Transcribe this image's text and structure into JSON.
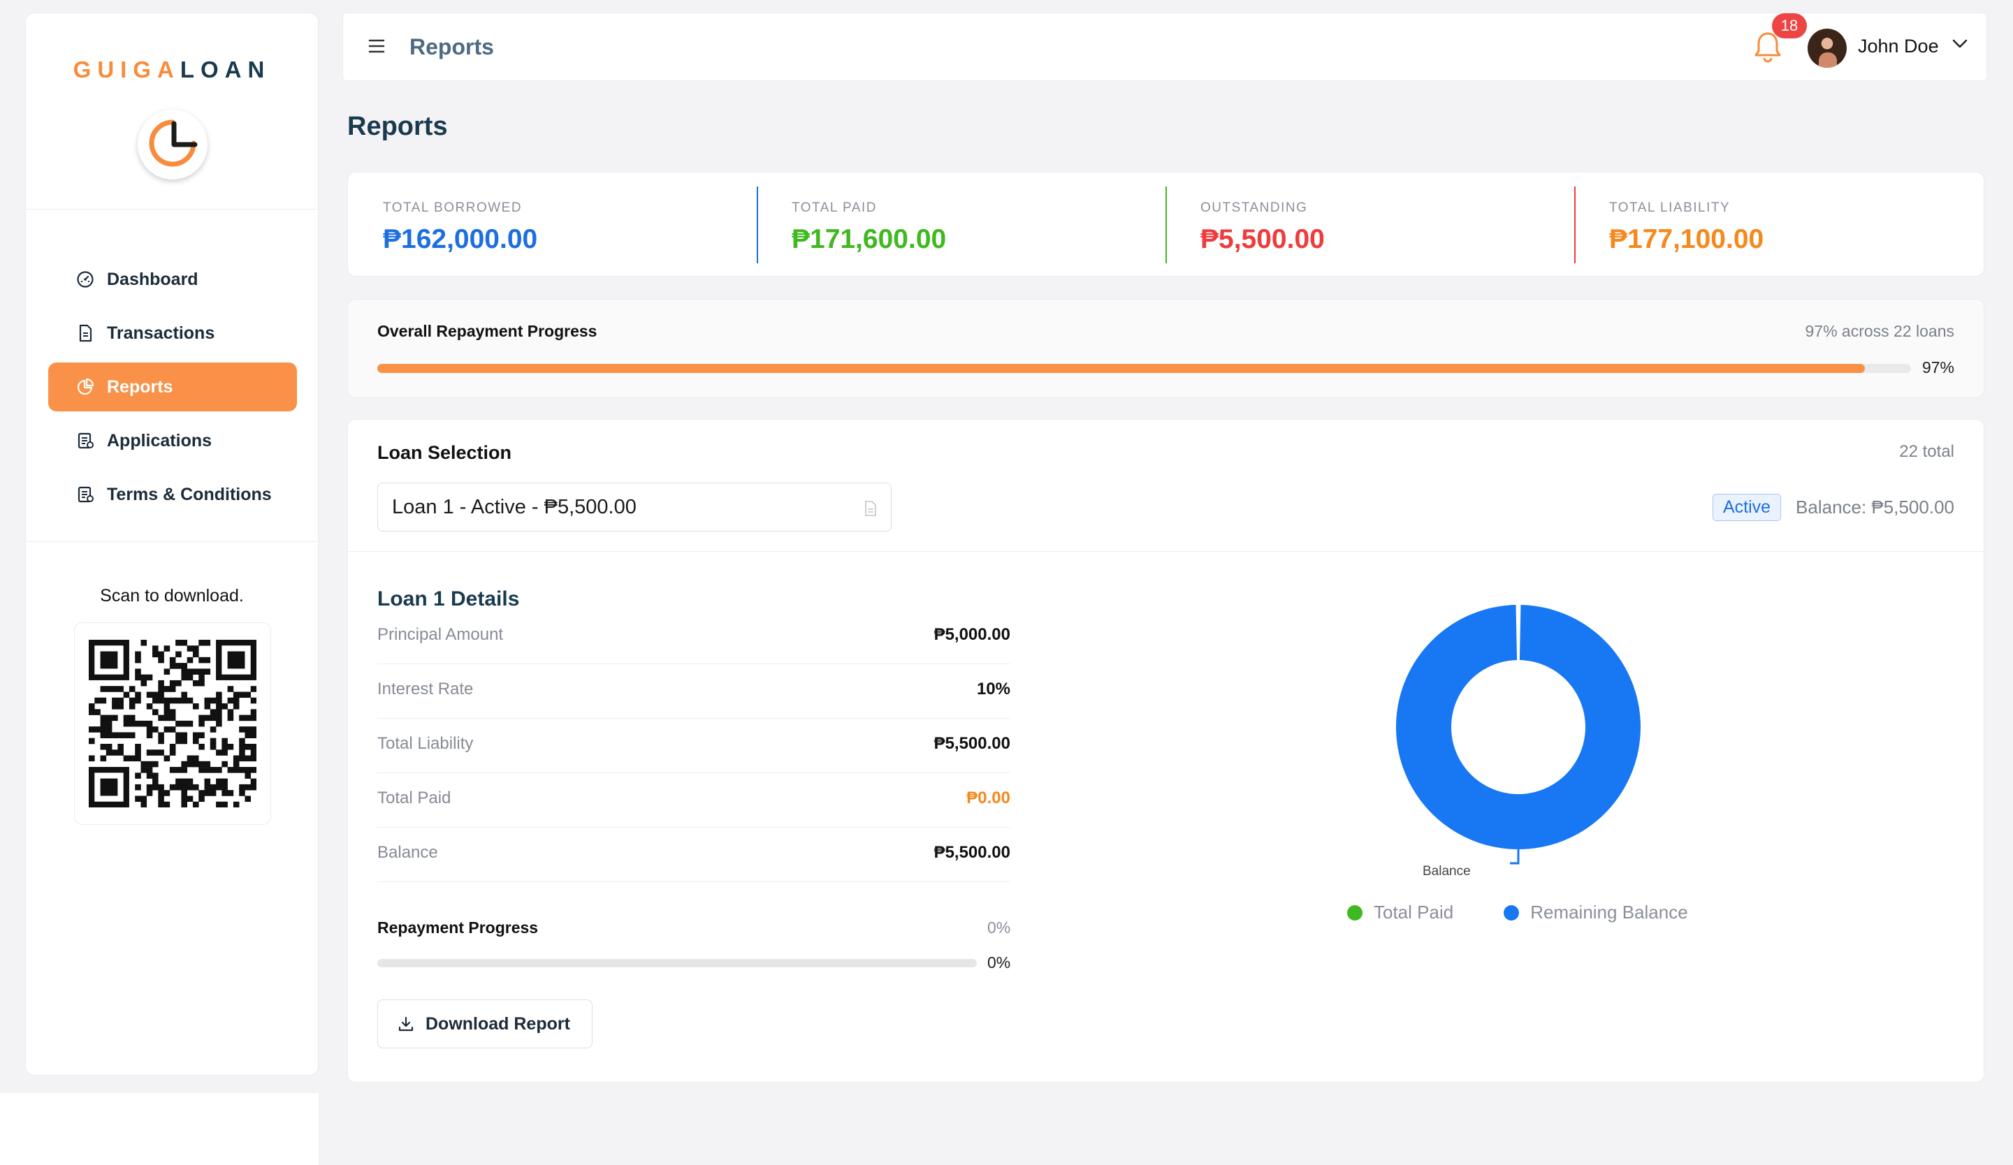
{
  "brand": {
    "part1": "GUIGA",
    "part2": "LOAN"
  },
  "sidebar": {
    "items": [
      {
        "label": "Dashboard",
        "icon": "dashboard-gauge-icon"
      },
      {
        "label": "Transactions",
        "icon": "document-icon"
      },
      {
        "label": "Reports",
        "icon": "pie-chart-icon",
        "active": true
      },
      {
        "label": "Applications",
        "icon": "clipboard-icon"
      },
      {
        "label": "Terms & Conditions",
        "icon": "clipboard-list-icon"
      }
    ],
    "scan_text": "Scan to download."
  },
  "header": {
    "title": "Reports",
    "notification_count": "18",
    "user_name": "John Doe"
  },
  "page": {
    "title": "Reports"
  },
  "stats": [
    {
      "label": "TOTAL BORROWED",
      "value": "₱162,000.00",
      "color": "#1d6fe0"
    },
    {
      "label": "TOTAL PAID",
      "value": "₱171,600.00",
      "color": "#3fb91f"
    },
    {
      "label": "OUTSTANDING",
      "value": "₱5,500.00",
      "color": "#ef3b3b"
    },
    {
      "label": "TOTAL LIABILITY",
      "value": "₱177,100.00",
      "color": "#f5891d"
    }
  ],
  "overall_progress": {
    "title": "Overall Repayment Progress",
    "summary": "97% across 22 loans",
    "percent_label": "97%",
    "percent": 97
  },
  "loan_selection": {
    "title": "Loan Selection",
    "total": "22 total",
    "selected": "Loan 1 - Active - ₱5,500.00",
    "status": "Active",
    "balance": "Balance: ₱5,500.00"
  },
  "details": {
    "title": "Loan 1 Details",
    "rows": [
      {
        "label": "Principal Amount",
        "value": "₱5,000.00"
      },
      {
        "label": "Interest Rate",
        "value": "10%"
      },
      {
        "label": "Total Liability",
        "value": "₱5,500.00"
      },
      {
        "label": "Total Paid",
        "value": "₱0.00",
        "color": "#f5891d"
      },
      {
        "label": "Balance",
        "value": "₱5,500.00"
      }
    ],
    "repayment_title": "Repayment Progress",
    "repayment_right": "0%",
    "repayment_pct": "0%",
    "repayment_percent": 0,
    "download_label": "Download Report"
  },
  "chart_data": {
    "type": "pie",
    "categories": [
      "Total Paid",
      "Remaining Balance"
    ],
    "values": [
      0,
      5500
    ],
    "colors": [
      "#3fb91f",
      "#1877f2"
    ],
    "annotations": [
      "Balance"
    ],
    "legend": "bottom"
  }
}
